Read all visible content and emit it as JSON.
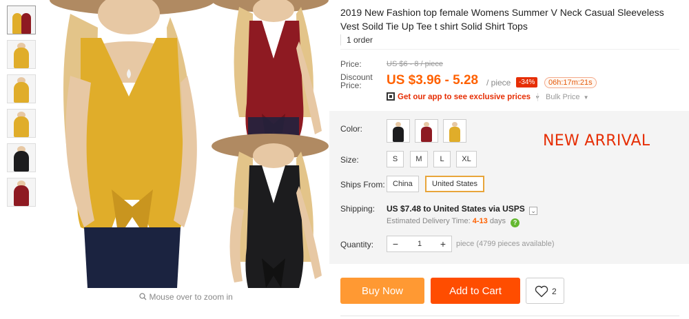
{
  "product": {
    "title": "2019 New Fashion top female Womens Summer V Neck Casual Sleeveless Vest Soild Tie Up Tee t shirt Solid Shirt Tops",
    "orders": "1 order"
  },
  "gallery": {
    "zoom_hint": "Mouse over to zoom in",
    "thumbnails": [
      "yellow-red pair",
      "yellow",
      "yellow",
      "yellow",
      "black",
      "red"
    ],
    "colors": {
      "yellow": "#e0ad2a",
      "red": "#8e1a22",
      "black": "#1c1c1e",
      "jeans": "#1b2340",
      "skin": "#e7c8a4",
      "hair": "#e3c489",
      "hat": "#b08a62"
    }
  },
  "pricing": {
    "price_label": "Price:",
    "original_price": "US $6 - 8 / piece",
    "discount_label": "Discount Price:",
    "discount_price": "US $3.96 - 5.28",
    "per_piece": "/ piece",
    "discount_badge": "-34%",
    "countdown": "06h:17m:21s",
    "app_promo": "Get our app to see exclusive prices",
    "bulk_price": "Bulk Price"
  },
  "options": {
    "color_label": "Color:",
    "color_swatches": [
      "black",
      "red",
      "yellow"
    ],
    "size_label": "Size:",
    "sizes": [
      "S",
      "M",
      "L",
      "XL"
    ],
    "ships_from_label": "Ships From:",
    "ships_from": [
      "China",
      "United States"
    ],
    "ships_from_selected": "United States",
    "banner": "NEW ARRIVAL"
  },
  "shipping": {
    "label": "Shipping:",
    "cost": "US $7.48",
    "destination": "to United States via USPS",
    "estimated_label": "Estimated Delivery Time:",
    "estimated_days": "4-13",
    "days_unit": "days"
  },
  "quantity": {
    "label": "Quantity:",
    "value": "1",
    "note": "piece (4799 pieces available)"
  },
  "actions": {
    "buy_now": "Buy Now",
    "add_to_cart": "Add to Cart",
    "wishlist_count": "2"
  }
}
